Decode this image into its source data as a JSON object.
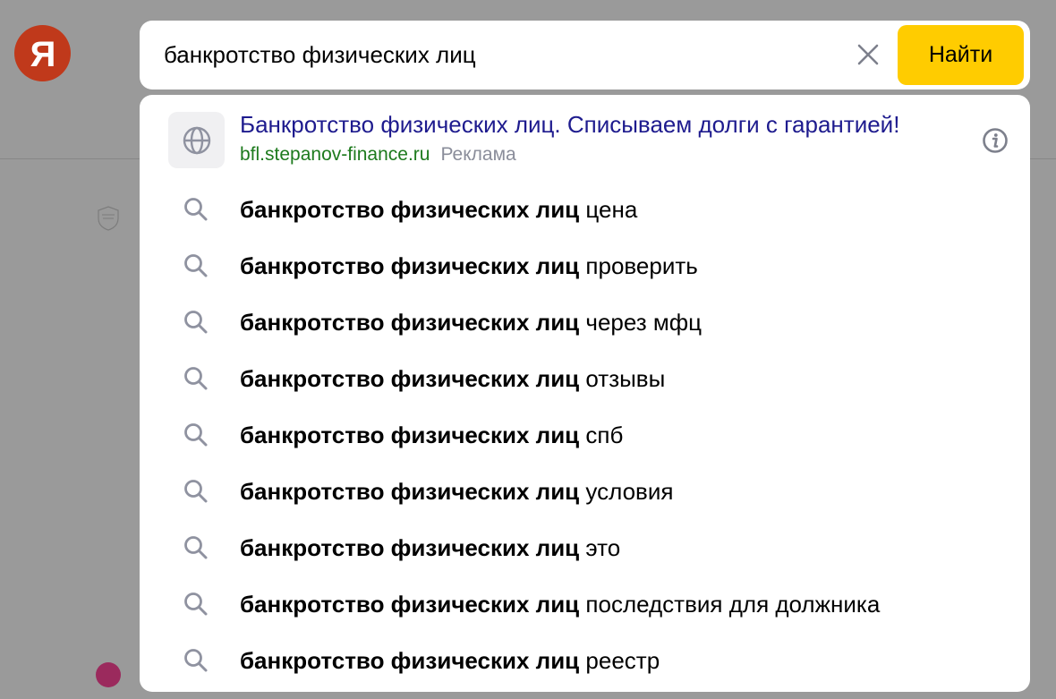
{
  "logo": {
    "letter": "Я",
    "color": "#c0391b"
  },
  "search": {
    "value": "банкротство физических лиц",
    "clear_icon": "close-icon",
    "button_label": "Найти",
    "button_color": "#ffcc00"
  },
  "ad": {
    "icon": "globe-icon",
    "title": "Банкротство физических лиц. Списываем долги с гарантией!",
    "url": "bfl.stepanov-finance.ru",
    "label": "Реклама",
    "info_icon": "info-icon"
  },
  "suggestions": [
    {
      "query": "банкротство физических лиц",
      "completion": "цена"
    },
    {
      "query": "банкротство физических лиц",
      "completion": "проверить"
    },
    {
      "query": "банкротство физических лиц",
      "completion": "через мфц"
    },
    {
      "query": "банкротство физических лиц",
      "completion": "отзывы"
    },
    {
      "query": "банкротство физических лиц",
      "completion": "спб"
    },
    {
      "query": "банкротство физических лиц",
      "completion": "условия"
    },
    {
      "query": "банкротство физических лиц",
      "completion": "это"
    },
    {
      "query": "банкротство физических лиц",
      "completion": "последствия для должника"
    },
    {
      "query": "банкротство физических лиц",
      "completion": "реестр"
    }
  ]
}
